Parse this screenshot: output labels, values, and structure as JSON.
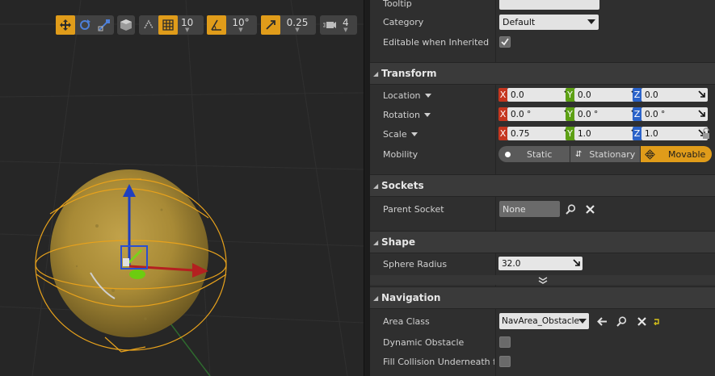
{
  "viewport": {
    "toolbar": {
      "grid_snap_value": "10",
      "rotation_snap_value": "10°",
      "scale_snap_value": "0.25",
      "camera_speed_value": "4"
    }
  },
  "details": {
    "top_rows": {
      "tooltip_label": "Tooltip",
      "category_label": "Category",
      "category_value": "Default",
      "editable_label": "Editable when Inherited",
      "editable_checked": true
    },
    "transform": {
      "title": "Transform",
      "location_label": "Location",
      "rotation_label": "Rotation",
      "scale_label": "Scale",
      "mobility_label": "Mobility",
      "axis_x": "X",
      "axis_y": "Y",
      "axis_z": "Z",
      "location": [
        "0.0",
        "0.0",
        "0.0"
      ],
      "rotation": [
        "0.0 °",
        "0.0 °",
        "0.0 °"
      ],
      "scale": [
        "0.75",
        "1.0",
        "1.0"
      ],
      "mobility": {
        "static": "Static",
        "stationary": "Stationary",
        "movable": "Movable",
        "selected": "Movable"
      }
    },
    "sockets": {
      "title": "Sockets",
      "parent_socket_label": "Parent Socket",
      "parent_socket_value": "None"
    },
    "shape": {
      "title": "Shape",
      "sphere_radius_label": "Sphere Radius",
      "sphere_radius_value": "32.0"
    },
    "navigation": {
      "title": "Navigation",
      "area_class_label": "Area Class",
      "area_class_value": "NavArea_Obstacle",
      "dynamic_obstacle_label": "Dynamic Obstacle",
      "fill_collision_label": "Fill Collision Underneath for"
    }
  },
  "colors": {
    "accent": "#e09c1a",
    "x_axis": "#c5361f",
    "y_axis": "#5da015",
    "z_axis": "#2b63c9"
  }
}
